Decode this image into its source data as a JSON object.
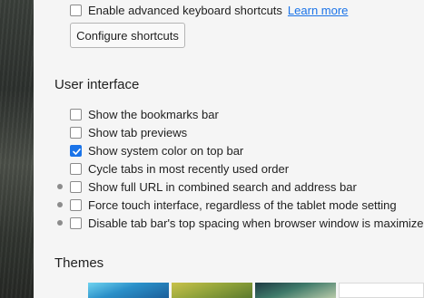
{
  "keyboard": {
    "advanced_shortcuts_label": "Enable advanced keyboard shortcuts",
    "learn_more": "Learn more",
    "configure_button": "Configure shortcuts"
  },
  "user_interface": {
    "title": "User interface",
    "options": [
      {
        "label": "Show the bookmarks bar",
        "checked": false,
        "modified": false
      },
      {
        "label": "Show tab previews",
        "checked": false,
        "modified": false
      },
      {
        "label": "Show system color on top bar",
        "checked": true,
        "modified": false
      },
      {
        "label": "Cycle tabs in most recently used order",
        "checked": false,
        "modified": false
      },
      {
        "label": "Show full URL in combined search and address bar",
        "checked": false,
        "modified": true
      },
      {
        "label": "Force touch interface, regardless of the tablet mode setting",
        "checked": false,
        "modified": true
      },
      {
        "label": "Disable tab bar's top spacing when browser window is maximized",
        "checked": false,
        "modified": true
      }
    ]
  },
  "themes": {
    "title": "Themes"
  },
  "colors": {
    "accent": "#1a73e8",
    "link": "#1a73e8"
  }
}
